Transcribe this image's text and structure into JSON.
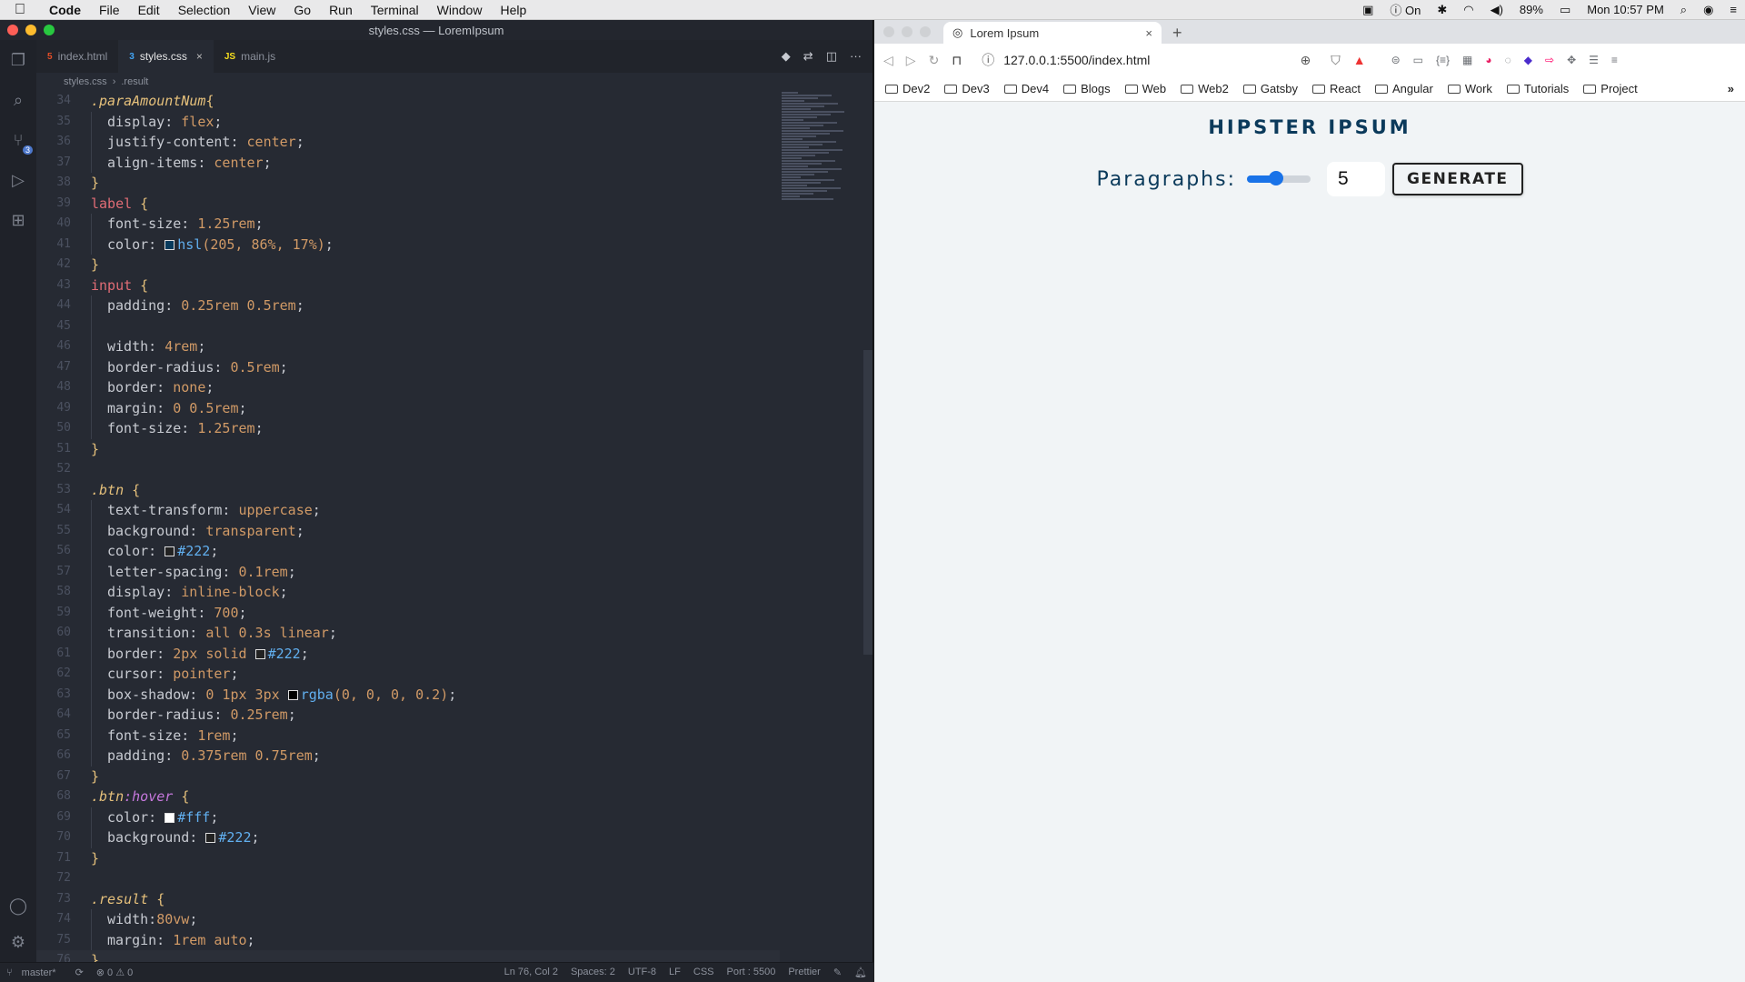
{
  "menubar": {
    "app": "Code",
    "items": [
      "File",
      "Edit",
      "Selection",
      "View",
      "Go",
      "Run",
      "Terminal",
      "Window",
      "Help"
    ],
    "status_on": "On",
    "battery": "89%",
    "clock": "Mon 10:57 PM"
  },
  "vscode": {
    "title": "styles.css — LoremIpsum",
    "scm_badge": "3",
    "tabs": [
      {
        "label": "index.html",
        "icon": "5"
      },
      {
        "label": "styles.css",
        "icon": "3"
      },
      {
        "label": "main.js",
        "icon": "JS"
      }
    ],
    "breadcrumb": [
      "styles.css",
      ".result"
    ],
    "status": {
      "branch": "master*",
      "problems": "⊗ 0 ⚠ 0",
      "position": "Ln 76, Col 2",
      "spaces": "Spaces: 2",
      "encoding": "UTF-8",
      "eol": "LF",
      "language": "CSS",
      "port": "Port : 5500",
      "formatter": "Prettier"
    },
    "lines": [
      {
        "n": "34",
        "i": 0,
        "t": [
          [
            ".paraAmountNum",
            "sel"
          ],
          [
            "{",
            "brace"
          ]
        ]
      },
      {
        "n": "35",
        "i": 1,
        "t": [
          [
            "display: ",
            "prop"
          ],
          [
            "flex",
            "val"
          ],
          [
            ";",
            "prop"
          ]
        ]
      },
      {
        "n": "36",
        "i": 1,
        "t": [
          [
            "justify-content: ",
            "prop"
          ],
          [
            "center",
            "val"
          ],
          [
            ";",
            "prop"
          ]
        ]
      },
      {
        "n": "37",
        "i": 1,
        "t": [
          [
            "align-items: ",
            "prop"
          ],
          [
            "center",
            "val"
          ],
          [
            ";",
            "prop"
          ]
        ]
      },
      {
        "n": "38",
        "i": 0,
        "t": [
          [
            "}",
            "brace"
          ]
        ]
      },
      {
        "n": "39",
        "i": 0,
        "t": [
          [
            "label",
            "tag"
          ],
          [
            " {",
            "brace"
          ]
        ]
      },
      {
        "n": "40",
        "i": 1,
        "t": [
          [
            "font-size: ",
            "prop"
          ],
          [
            "1.25rem",
            "val"
          ],
          [
            ";",
            "prop"
          ]
        ]
      },
      {
        "n": "41",
        "i": 1,
        "t": [
          [
            "color: ",
            "prop"
          ],
          [
            "#083a5c",
            "swatch"
          ],
          [
            "hsl",
            "func"
          ],
          [
            "(205, 86%, 17%)",
            "val"
          ],
          [
            ";",
            "prop"
          ]
        ]
      },
      {
        "n": "42",
        "i": 0,
        "t": [
          [
            "}",
            "brace"
          ]
        ]
      },
      {
        "n": "43",
        "i": 0,
        "t": [
          [
            "input",
            "tag"
          ],
          [
            " {",
            "brace"
          ]
        ]
      },
      {
        "n": "44",
        "i": 1,
        "t": [
          [
            "padding: ",
            "prop"
          ],
          [
            "0.25rem 0.5rem",
            "val"
          ],
          [
            ";",
            "prop"
          ]
        ]
      },
      {
        "n": "45",
        "i": 1,
        "t": []
      },
      {
        "n": "46",
        "i": 1,
        "t": [
          [
            "width: ",
            "prop"
          ],
          [
            "4rem",
            "val"
          ],
          [
            ";",
            "prop"
          ]
        ]
      },
      {
        "n": "47",
        "i": 1,
        "t": [
          [
            "border-radius: ",
            "prop"
          ],
          [
            "0.5rem",
            "val"
          ],
          [
            ";",
            "prop"
          ]
        ]
      },
      {
        "n": "48",
        "i": 1,
        "t": [
          [
            "border: ",
            "prop"
          ],
          [
            "none",
            "val"
          ],
          [
            ";",
            "prop"
          ]
        ]
      },
      {
        "n": "49",
        "i": 1,
        "t": [
          [
            "margin: ",
            "prop"
          ],
          [
            "0 0.5rem",
            "val"
          ],
          [
            ";",
            "prop"
          ]
        ]
      },
      {
        "n": "50",
        "i": 1,
        "t": [
          [
            "font-size: ",
            "prop"
          ],
          [
            "1.25rem",
            "val"
          ],
          [
            ";",
            "prop"
          ]
        ]
      },
      {
        "n": "51",
        "i": 0,
        "t": [
          [
            "}",
            "brace"
          ]
        ]
      },
      {
        "n": "52",
        "i": 0,
        "t": []
      },
      {
        "n": "53",
        "i": 0,
        "t": [
          [
            ".btn",
            "sel"
          ],
          [
            " {",
            "brace"
          ]
        ]
      },
      {
        "n": "54",
        "i": 1,
        "t": [
          [
            "text-transform: ",
            "prop"
          ],
          [
            "uppercase",
            "val"
          ],
          [
            ";",
            "prop"
          ]
        ]
      },
      {
        "n": "55",
        "i": 1,
        "t": [
          [
            "background: ",
            "prop"
          ],
          [
            "transparent",
            "val"
          ],
          [
            ";",
            "prop"
          ]
        ]
      },
      {
        "n": "56",
        "i": 1,
        "t": [
          [
            "color: ",
            "prop"
          ],
          [
            "#222222",
            "swatch"
          ],
          [
            "#222",
            "func"
          ],
          [
            ";",
            "prop"
          ]
        ]
      },
      {
        "n": "57",
        "i": 1,
        "t": [
          [
            "letter-spacing: ",
            "prop"
          ],
          [
            "0.1rem",
            "val"
          ],
          [
            ";",
            "prop"
          ]
        ]
      },
      {
        "n": "58",
        "i": 1,
        "t": [
          [
            "display: ",
            "prop"
          ],
          [
            "inline-block",
            "val"
          ],
          [
            ";",
            "prop"
          ]
        ]
      },
      {
        "n": "59",
        "i": 1,
        "t": [
          [
            "font-weight: ",
            "prop"
          ],
          [
            "700",
            "val"
          ],
          [
            ";",
            "prop"
          ]
        ]
      },
      {
        "n": "60",
        "i": 1,
        "t": [
          [
            "transition: ",
            "prop"
          ],
          [
            "all 0.3s linear",
            "val"
          ],
          [
            ";",
            "prop"
          ]
        ]
      },
      {
        "n": "61",
        "i": 1,
        "t": [
          [
            "border: ",
            "prop"
          ],
          [
            "2px solid ",
            "val"
          ],
          [
            "#222222",
            "swatch"
          ],
          [
            "#222",
            "func"
          ],
          [
            ";",
            "prop"
          ]
        ]
      },
      {
        "n": "62",
        "i": 1,
        "t": [
          [
            "cursor: ",
            "prop"
          ],
          [
            "pointer",
            "val"
          ],
          [
            ";",
            "prop"
          ]
        ]
      },
      {
        "n": "63",
        "i": 1,
        "t": [
          [
            "box-shadow: ",
            "prop"
          ],
          [
            "0 1px 3px ",
            "val"
          ],
          [
            "#000000",
            "swatch"
          ],
          [
            "rgba",
            "func"
          ],
          [
            "(0, 0, 0, 0.2)",
            "val"
          ],
          [
            ";",
            "prop"
          ]
        ]
      },
      {
        "n": "64",
        "i": 1,
        "t": [
          [
            "border-radius: ",
            "prop"
          ],
          [
            "0.25rem",
            "val"
          ],
          [
            ";",
            "prop"
          ]
        ]
      },
      {
        "n": "65",
        "i": 1,
        "t": [
          [
            "font-size: ",
            "prop"
          ],
          [
            "1rem",
            "val"
          ],
          [
            ";",
            "prop"
          ]
        ]
      },
      {
        "n": "66",
        "i": 1,
        "t": [
          [
            "padding: ",
            "prop"
          ],
          [
            "0.375rem 0.75rem",
            "val"
          ],
          [
            ";",
            "prop"
          ]
        ]
      },
      {
        "n": "67",
        "i": 0,
        "t": [
          [
            "}",
            "brace"
          ]
        ]
      },
      {
        "n": "68",
        "i": 0,
        "t": [
          [
            ".btn",
            "sel"
          ],
          [
            ":hover",
            "pseudo"
          ],
          [
            " {",
            "brace"
          ]
        ]
      },
      {
        "n": "69",
        "i": 1,
        "t": [
          [
            "color: ",
            "prop"
          ],
          [
            "#ffffff",
            "swatch"
          ],
          [
            "#fff",
            "func"
          ],
          [
            ";",
            "prop"
          ]
        ]
      },
      {
        "n": "70",
        "i": 1,
        "t": [
          [
            "background: ",
            "prop"
          ],
          [
            "#222222",
            "swatch"
          ],
          [
            "#222",
            "func"
          ],
          [
            ";",
            "prop"
          ]
        ]
      },
      {
        "n": "71",
        "i": 0,
        "t": [
          [
            "}",
            "brace"
          ]
        ]
      },
      {
        "n": "72",
        "i": 0,
        "t": []
      },
      {
        "n": "73",
        "i": 0,
        "t": [
          [
            ".result",
            "sel"
          ],
          [
            " {",
            "brace"
          ]
        ]
      },
      {
        "n": "74",
        "i": 1,
        "t": [
          [
            "width:",
            "prop"
          ],
          [
            "80vw",
            "val"
          ],
          [
            ";",
            "prop"
          ]
        ]
      },
      {
        "n": "75",
        "i": 1,
        "t": [
          [
            "margin: ",
            "prop"
          ],
          [
            "1rem auto",
            "val"
          ],
          [
            ";",
            "prop"
          ]
        ]
      },
      {
        "n": "76",
        "i": 0,
        "t": [
          [
            "}",
            "brace"
          ]
        ]
      }
    ]
  },
  "browser": {
    "tab_title": "Lorem Ipsum",
    "url": "127.0.0.1:5500/index.html",
    "bookmarks": [
      "Dev2",
      "Dev3",
      "Dev4",
      "Blogs",
      "Web",
      "Web2",
      "Gatsby",
      "React",
      "Angular",
      "Work",
      "Tutorials",
      "Project"
    ],
    "page": {
      "heading": "HIPSTER IPSUM",
      "label": "Paragraphs:",
      "slider_fraction": 0.45,
      "amount": "5",
      "button": "GENERATE"
    }
  },
  "colors": {
    "accent": "#1a73e8",
    "heading": "#0b3a5b",
    "editor_bg": "#262a33"
  }
}
